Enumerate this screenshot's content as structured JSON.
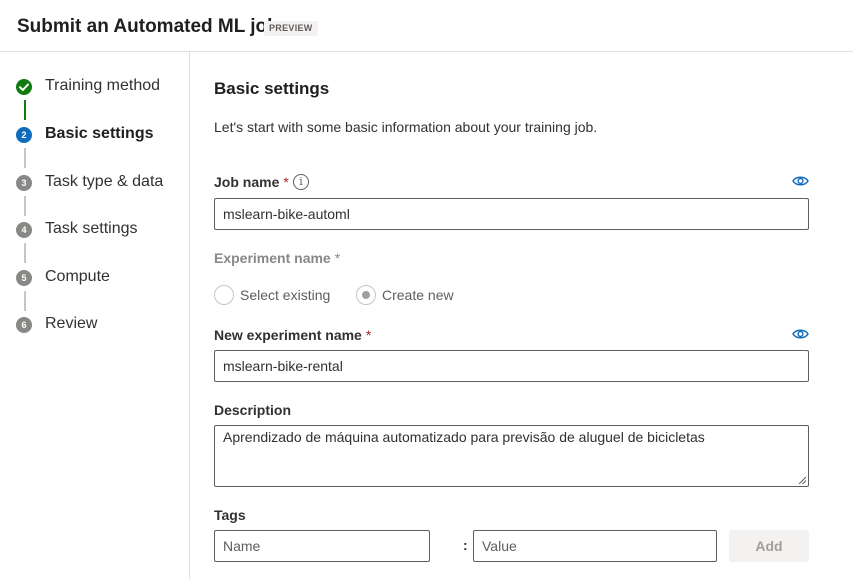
{
  "header": {
    "title": "Submit an Automated ML job",
    "badge": "PREVIEW"
  },
  "steps": [
    {
      "num": "✓",
      "label": "Training method",
      "state": "done"
    },
    {
      "num": "2",
      "label": "Basic settings",
      "state": "active"
    },
    {
      "num": "3",
      "label": "Task type & data",
      "state": "pending"
    },
    {
      "num": "4",
      "label": "Task settings",
      "state": "pending"
    },
    {
      "num": "5",
      "label": "Compute",
      "state": "pending"
    },
    {
      "num": "6",
      "label": "Review",
      "state": "pending"
    }
  ],
  "main": {
    "title": "Basic settings",
    "intro": "Let's start with some basic information about your training job.",
    "job_name": {
      "label": "Job name",
      "required": "*",
      "value": "mslearn-bike-automl"
    },
    "experiment": {
      "label": "Experiment name",
      "required": "*",
      "option_existing": "Select existing",
      "option_new": "Create new",
      "selected": "Create new"
    },
    "new_experiment": {
      "label": "New experiment name",
      "required": "*",
      "value": "mslearn-bike-rental"
    },
    "description": {
      "label": "Description",
      "value": "Aprendizado de máquina automatizado para previsão de aluguel de bicicletas"
    },
    "tags": {
      "label": "Tags",
      "name_placeholder": "Name",
      "separator": ":",
      "value_placeholder": "Value",
      "add_label": "Add"
    }
  },
  "icons": {
    "info": "info-icon",
    "eye": "eye-icon",
    "check": "checkmark-icon"
  },
  "colors": {
    "accent": "#0f6cbd",
    "success": "#107c10",
    "required": "#a4262c"
  }
}
